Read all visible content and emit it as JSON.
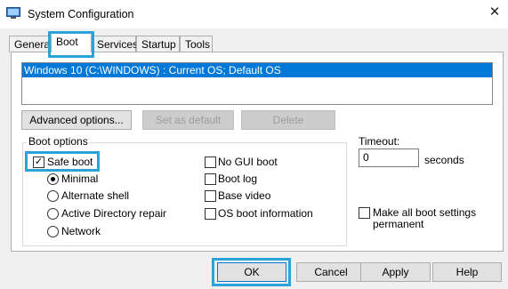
{
  "window": {
    "title": "System Configuration",
    "close_glyph": "✕"
  },
  "tabs": [
    "General",
    "Boot",
    "Services",
    "Startup",
    "Tools"
  ],
  "os_list": {
    "selected": "Windows 10 (C:\\WINDOWS) : Current OS; Default OS"
  },
  "actions": {
    "advanced": "Advanced options...",
    "set_default": "Set as default",
    "delete": "Delete"
  },
  "boot_options": {
    "label": "Boot options",
    "safe_boot": {
      "label": "Safe boot",
      "checked": true
    },
    "radios": [
      {
        "label": "Minimal",
        "selected": true
      },
      {
        "label": "Alternate shell",
        "selected": false
      },
      {
        "label": "Active Directory repair",
        "selected": false
      },
      {
        "label": "Network",
        "selected": false
      }
    ],
    "checks": [
      {
        "label": "No GUI boot",
        "checked": false
      },
      {
        "label": "Boot log",
        "checked": false
      },
      {
        "label": "Base video",
        "checked": false
      },
      {
        "label": "OS boot information",
        "checked": false
      }
    ]
  },
  "timeout": {
    "label": "Timeout:",
    "value": "0",
    "unit": "seconds"
  },
  "permanent": {
    "label_line1": "Make all boot settings",
    "label_line2": "permanent",
    "checked": false
  },
  "buttons": {
    "ok": "OK",
    "cancel": "Cancel",
    "apply": "Apply",
    "help": "Help"
  },
  "colors": {
    "highlight": "#29a3d8",
    "selection": "#0078d7"
  }
}
